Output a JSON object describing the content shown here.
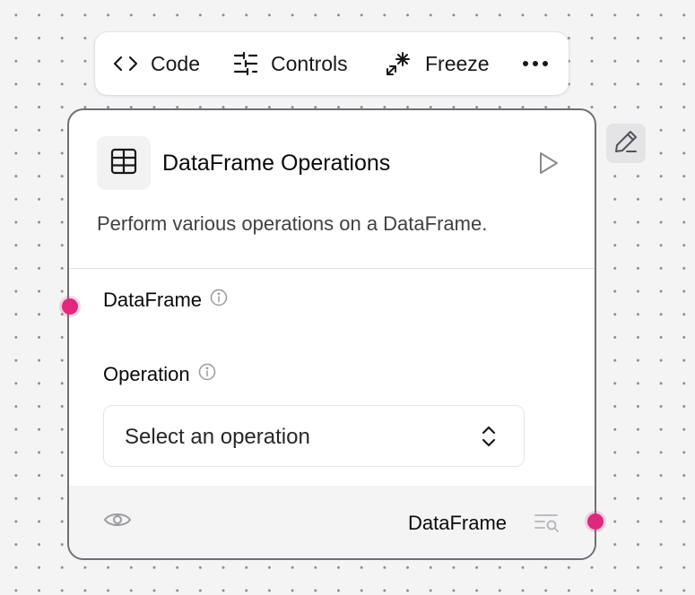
{
  "toolbar": {
    "code_label": "Code",
    "controls_label": "Controls",
    "freeze_label": "Freeze",
    "more_icon": "more-horizontal-icon"
  },
  "node": {
    "icon": "table-icon",
    "title": "DataFrame Operations",
    "description": "Perform various operations on a DataFrame.",
    "inputs": [
      {
        "label": "DataFrame",
        "icon": "info-icon"
      },
      {
        "label": "Operation",
        "icon": "info-icon"
      }
    ],
    "operation_select": {
      "placeholder": "Select an operation",
      "icon": "chevrons-up-down-icon"
    },
    "output": {
      "label": "DataFrame",
      "visibility_icon": "eye-icon",
      "inspect_icon": "text-search-icon"
    }
  },
  "colors": {
    "handle": "#e0287d",
    "node_border": "#6e6e75",
    "canvas": "#f4f4f5"
  }
}
